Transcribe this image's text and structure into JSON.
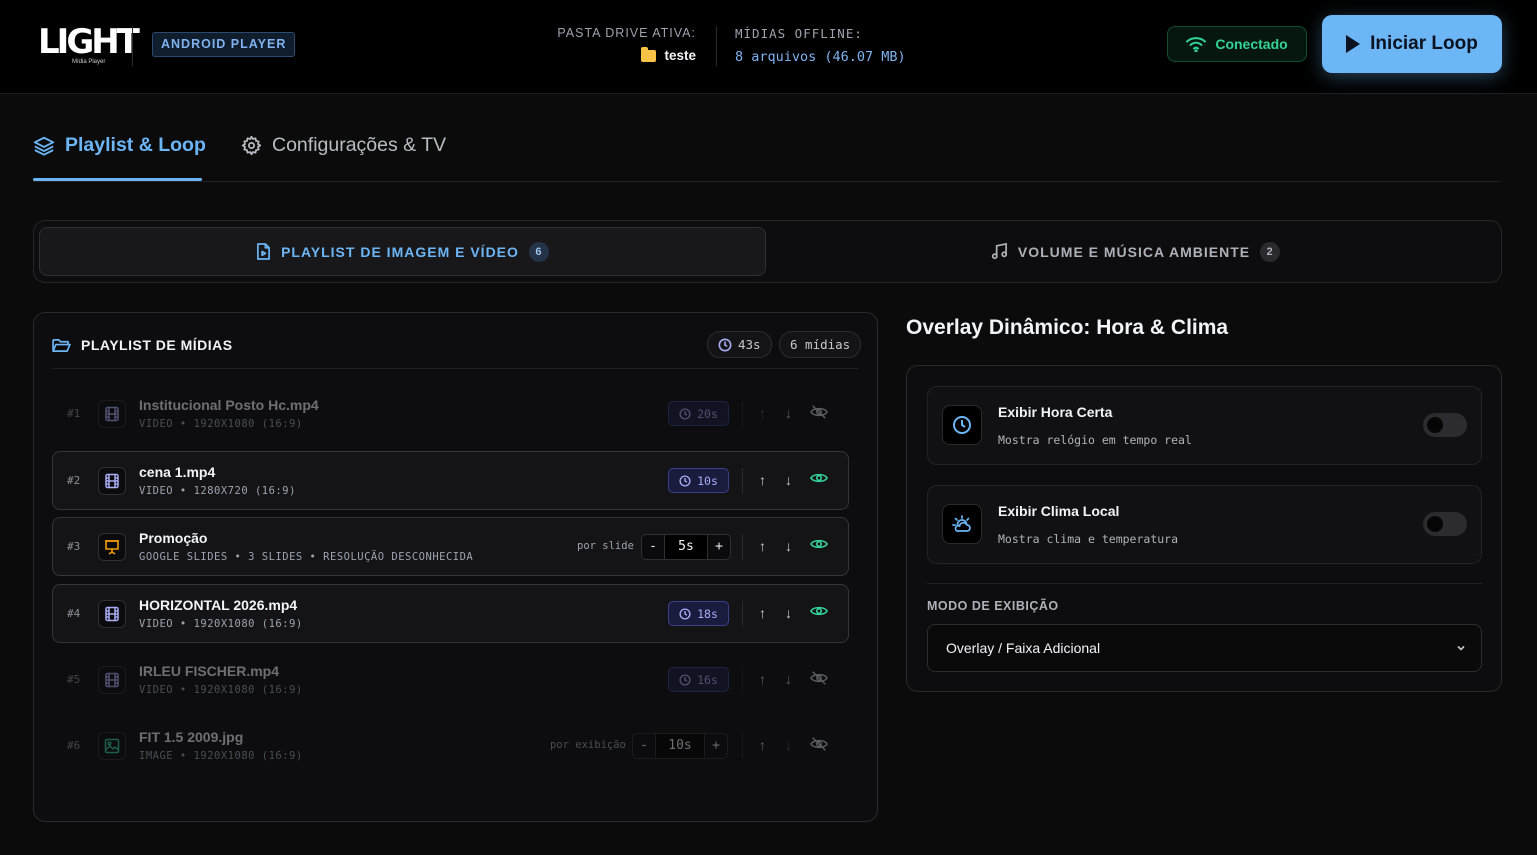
{
  "header": {
    "logo_text": "LIGHT",
    "logo_sub": "Mídia Player",
    "platform_badge": "ANDROID PLAYER",
    "drive_label": "PASTA DRIVE ATIVA:",
    "drive_value": "teste",
    "offline_label": "MÍDIAS OFFLINE:",
    "offline_value": "8 arquivos (46.07 MB)",
    "status": "Conectado",
    "start_button": "Iniciar Loop",
    "colors": {
      "accent": "#6cb6f6",
      "success": "#34d399",
      "folder": "#f6c344"
    }
  },
  "tabs": [
    {
      "label": "Playlist & Loop",
      "icon": "layers-icon",
      "active": true
    },
    {
      "label": "Configurações & TV",
      "icon": "gear-icon",
      "active": false
    }
  ],
  "segments": [
    {
      "label": "PLAYLIST DE IMAGEM E VÍDEO",
      "count": "6",
      "icon": "file-icon",
      "active": true
    },
    {
      "label": "VOLUME E MÚSICA AMBIENTE",
      "count": "2",
      "icon": "music-icon",
      "active": false
    }
  ],
  "playlist": {
    "title": "PLAYLIST DE MÍDIAS",
    "total_duration": "43s",
    "media_count": "6 mídias",
    "items": [
      {
        "num": "#1",
        "name": "Institucional Posto Hc.mp4",
        "meta": "VIDEO • 1920X1080 (16:9)",
        "duration": "20s",
        "type": "video",
        "enabled": false
      },
      {
        "num": "#2",
        "name": "cena 1.mp4",
        "meta": "VIDEO • 1280X720 (16:9)",
        "duration": "10s",
        "type": "video",
        "enabled": true
      },
      {
        "num": "#3",
        "name": "Promoção",
        "meta": "GOOGLE SLIDES • 3 SLIDES • RESOLUÇÃO DESCONHECIDA",
        "per_label": "por slide",
        "step_value": "5s",
        "type": "slides",
        "enabled": true
      },
      {
        "num": "#4",
        "name": "HORIZONTAL 2026.mp4",
        "meta": "VIDEO • 1920X1080 (16:9)",
        "duration": "18s",
        "type": "video",
        "enabled": true
      },
      {
        "num": "#5",
        "name": "IRLEU FISCHER.mp4",
        "meta": "VIDEO • 1920X1080 (16:9)",
        "duration": "16s",
        "type": "video",
        "enabled": false
      },
      {
        "num": "#6",
        "name": "FIT 1.5 2009.jpg",
        "meta": "IMAGE • 1920X1080 (16:9)",
        "per_label": "por exibição",
        "step_value": "10s",
        "type": "image",
        "enabled": false
      }
    ]
  },
  "overlay": {
    "title": "Overlay Dinâmico: Hora & Clima",
    "items": [
      {
        "name": "Exibir Hora Certa",
        "desc": "Mostra relógio em tempo real",
        "icon": "clock-icon",
        "enabled": false
      },
      {
        "name": "Exibir Clima Local",
        "desc": "Mostra clima e temperatura",
        "icon": "weather-icon",
        "enabled": false
      }
    ],
    "mode_label": "MODO DE EXIBIÇÃO",
    "mode_value": "Overlay / Faixa Adicional"
  }
}
